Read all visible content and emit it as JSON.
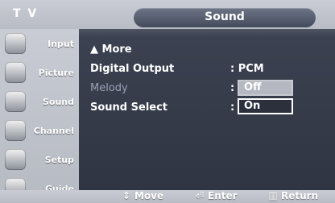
{
  "header": {
    "left_label": "T V",
    "tab_title": "Sound"
  },
  "sidebar": {
    "items": [
      {
        "label": "Input",
        "icon": "input-icon"
      },
      {
        "label": "Picture",
        "icon": "picture-icon"
      },
      {
        "label": "Sound",
        "icon": "sound-icon",
        "active": true
      },
      {
        "label": "Channel",
        "icon": "channel-icon"
      },
      {
        "label": "Setup",
        "icon": "setup-icon"
      },
      {
        "label": "Guide",
        "icon": "guide-icon"
      }
    ]
  },
  "menu": {
    "more_label": "▲ More",
    "digital_output": {
      "label": "Digital Output",
      "value": ": PCM"
    },
    "melody": {
      "label": "Melody",
      "colon": ":"
    },
    "sound_select": {
      "label": "Sound Select",
      "colon": ":"
    },
    "options": {
      "off": "Off",
      "on": "On"
    }
  },
  "footer": {
    "move": "Move",
    "enter": "Enter",
    "return": "Return"
  },
  "colors": {
    "accent_panel": "#2f3542",
    "chrome": "#c9ccd4",
    "highlight": "#b5b8c0"
  }
}
